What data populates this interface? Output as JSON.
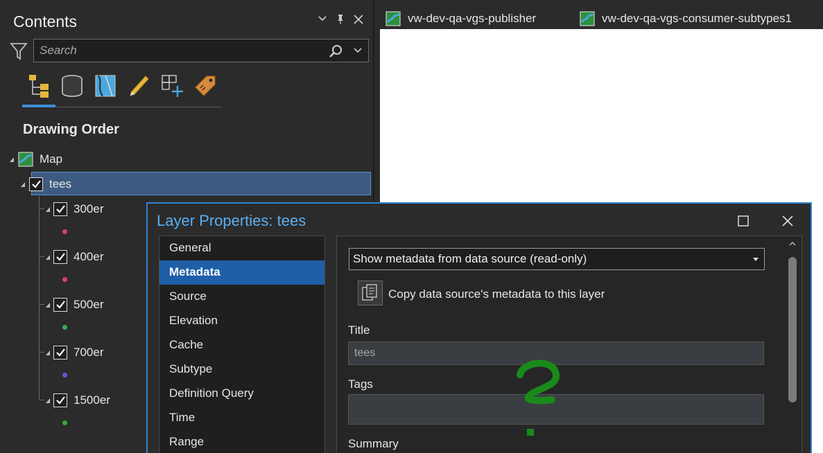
{
  "contents": {
    "title": "Contents",
    "search_placeholder": "Search",
    "section_title": "Drawing Order",
    "map_label": "Map",
    "layer_label": "tees",
    "sublayers": [
      {
        "label": "300er",
        "color": "#d9435c"
      },
      {
        "label": "400er",
        "color": "#d9435c"
      },
      {
        "label": "500er",
        "color": "#3aaa5a"
      },
      {
        "label": "700er",
        "color": "#5a5ad8"
      },
      {
        "label": "1500er",
        "color": "#3aaa3a"
      }
    ]
  },
  "tabs": [
    {
      "label": "vw-dev-qa-vgs-publisher"
    },
    {
      "label": "vw-dev-qa-vgs-consumer-subtypes1"
    }
  ],
  "dialog": {
    "title": "Layer Properties: tees",
    "nav": [
      "General",
      "Metadata",
      "Source",
      "Elevation",
      "Cache",
      "Subtype",
      "Definition Query",
      "Time",
      "Range"
    ],
    "active_nav": "Metadata",
    "metadata_mode": "Show metadata from data source (read-only)",
    "copy_label": "Copy data source's metadata to this layer",
    "title_label": "Title",
    "title_value": "tees",
    "tags_label": "Tags",
    "tags_value": "",
    "summary_label": "Summary"
  },
  "colors": {
    "accent": "#2f84d2",
    "selection": "#3d5a80",
    "annotation": "#1a8a1a"
  }
}
